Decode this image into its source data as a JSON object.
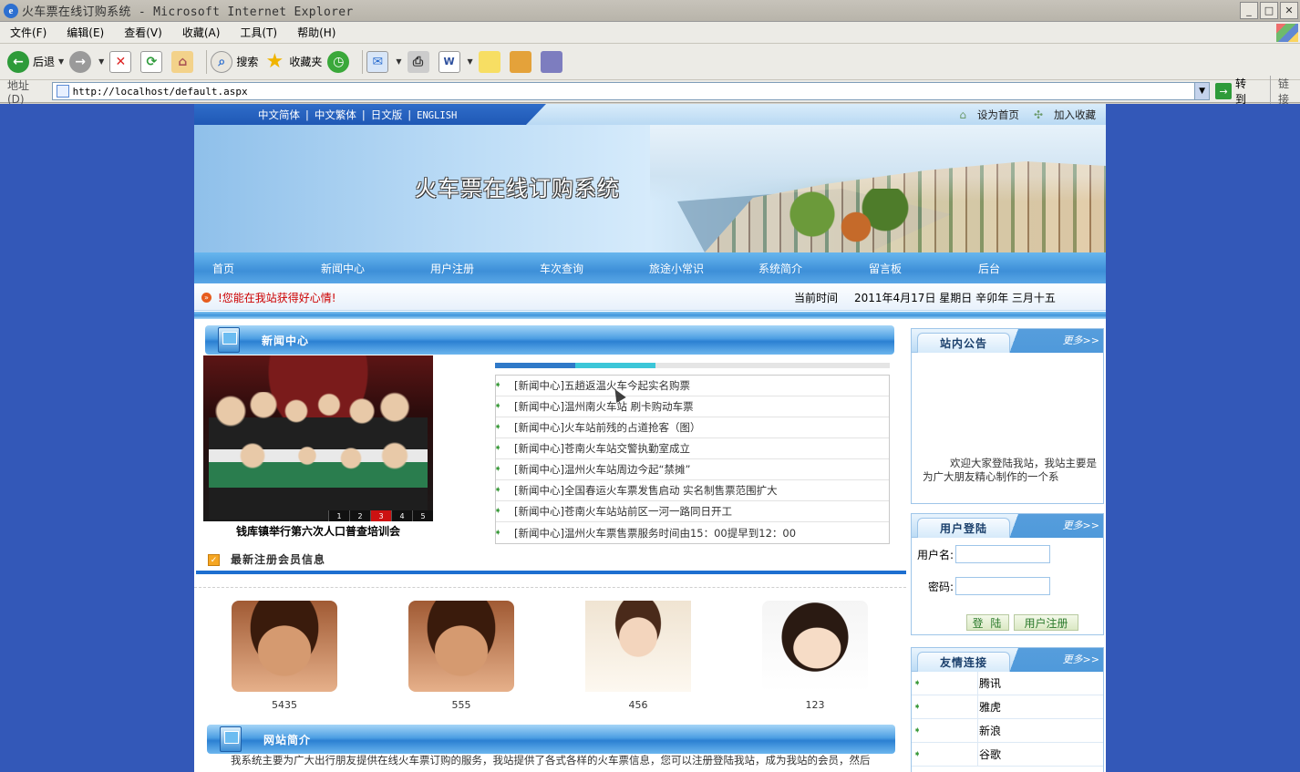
{
  "window": {
    "title": "火车票在线订购系统 - Microsoft Internet Explorer",
    "buttons": [
      "_",
      "□",
      "✕"
    ]
  },
  "menu": [
    "文件(F)",
    "编辑(E)",
    "查看(V)",
    "收藏(A)",
    "工具(T)",
    "帮助(H)"
  ],
  "toolbar": {
    "back": "后退",
    "search": "搜索",
    "favorites": "收藏夹"
  },
  "address": {
    "label": "地址(D)",
    "url": "http://localhost/default.aspx",
    "go": "转到",
    "links": "链接"
  },
  "site": {
    "langs": [
      "中文简体",
      "中文繁体",
      "日文版",
      "ENGLISH"
    ],
    "set_home": "设为首页",
    "add_fav": "加入收藏",
    "title": "火车票在线订购系统",
    "nav": [
      "首页",
      "新闻中心",
      "用户注册",
      "车次查询",
      "旅途小常识",
      "系统简介",
      "留言板",
      "后台"
    ],
    "ticker": {
      "message": "!您能在我站获得好心情!",
      "time_label": "当前时间",
      "time_value": "2011年4月17日 星期日 辛卯年 三月十五"
    },
    "news": {
      "heading": "新闻中心",
      "photo_caption": "钱库镇举行第六次人口普查培训会",
      "photo_pages": [
        "1",
        "2",
        "3",
        "4",
        "5"
      ],
      "items": [
        {
          "cat": "[新闻中心]",
          "title": "五趟返温火车今起实名购票"
        },
        {
          "cat": "[新闻中心]",
          "title": "温州南火车站 刷卡购动车票"
        },
        {
          "cat": "[新闻中心]",
          "title": "火车站前残的占道抢客（图）"
        },
        {
          "cat": "[新闻中心]",
          "title": "苍南火车站交警执勤室成立"
        },
        {
          "cat": "[新闻中心]",
          "title": "温州火车站周边今起“禁摊”"
        },
        {
          "cat": "[新闻中心]",
          "title": "全国春运火车票发售启动 实名制售票范围扩大"
        },
        {
          "cat": "[新闻中心]",
          "title": "苍南火车站站前区一河一路同日开工"
        },
        {
          "cat": "[新闻中心]",
          "title": "温州火车票售票服务时间由15：00提早到12：00"
        }
      ]
    },
    "members": {
      "heading": "最新注册会员信息",
      "list": [
        {
          "name": "5435"
        },
        {
          "name": "555"
        },
        {
          "name": "456"
        },
        {
          "name": "123"
        }
      ]
    },
    "intro": {
      "heading": "网站简介",
      "text": "我系统主要为广大出行朋友提供在线火车票订购的服务，我站提供了各式各样的火车票信息，您可以注册登陆我站，成为我站的会员，然后"
    },
    "notice": {
      "heading": "站内公告",
      "more": "更多>>",
      "text": "欢迎大家登陆我站，我站主要是为广大朋友精心制作的一个系"
    },
    "login": {
      "heading": "用户登陆",
      "more": "更多>>",
      "user_label": "用户名:",
      "pass_label": "密码:",
      "login_btn": "登 陆",
      "register_btn": "用户注册"
    },
    "friends": {
      "heading": "友情连接",
      "more": "更多>>",
      "list": [
        "腾讯",
        "雅虎",
        "新浪",
        "谷歌"
      ]
    }
  }
}
